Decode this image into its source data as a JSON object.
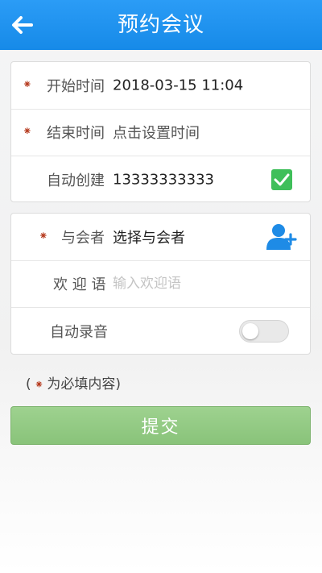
{
  "header": {
    "title": "预约会议",
    "back_icon": "arrow-left-icon"
  },
  "form": {
    "required_mark": "⁕",
    "start_time": {
      "label": "开始时间",
      "value": "2018-03-15 11:04",
      "required": true
    },
    "end_time": {
      "label": "结束时间",
      "value": "点击设置时间",
      "required": true
    },
    "auto_create": {
      "label": "自动创建",
      "value": "13333333333",
      "checked": true,
      "checkbox_icon": "checkmark-icon"
    },
    "participants": {
      "label": "与会者",
      "value": "选择与会者",
      "required": true,
      "add_icon": "add-user-icon"
    },
    "welcome": {
      "label": "欢 迎 语",
      "value": "",
      "placeholder": "输入欢迎语"
    },
    "auto_record": {
      "label": "自动录音",
      "enabled": false
    }
  },
  "note": {
    "open": "(",
    "text": "为必填内容)"
  },
  "submit_label": "提交",
  "colors": {
    "header_blue": "#168ae8",
    "required_red": "#b63a1e",
    "checkbox_green": "#3fbf5a",
    "submit_green": "#89c37a",
    "icon_blue": "#1e8be6"
  }
}
